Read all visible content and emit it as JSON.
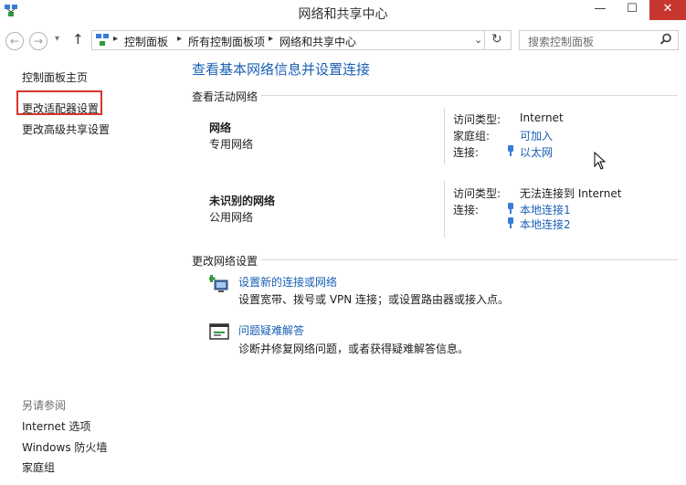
{
  "window": {
    "title": "网络和共享中心",
    "minimize": "—",
    "maximize": "☐",
    "close": "✕"
  },
  "addressbar": {
    "back": "←",
    "forward": "→",
    "dropdown": "▾",
    "up": "↑",
    "crumbs": [
      "控制面板",
      "所有控制面板项",
      "网络和共享中心"
    ],
    "search_placeholder": "搜索控制面板"
  },
  "sidebar": {
    "home": "控制面板主页",
    "items": [
      "更改适配器设置",
      "更改高级共享设置"
    ],
    "see_also_title": "另请参阅",
    "see_also": [
      "Internet 选项",
      "Windows 防火墙",
      "家庭组"
    ]
  },
  "main": {
    "heading": "查看基本网络信息并设置连接",
    "active_networks_title": "查看活动网络",
    "networks": [
      {
        "name": "网络",
        "type": "专用网络",
        "access_label": "访问类型:",
        "access_value": "Internet",
        "homegroup_label": "家庭组:",
        "homegroup_value": "可加入",
        "conn_label": "连接:",
        "connections": [
          "以太网"
        ]
      },
      {
        "name": "未识别的网络",
        "type": "公用网络",
        "access_label": "访问类型:",
        "access_value": "无法连接到 Internet",
        "conn_label": "连接:",
        "connections": [
          "本地连接1",
          "本地连接2"
        ]
      }
    ],
    "change_settings_title": "更改网络设置",
    "tasks": [
      {
        "title": "设置新的连接或网络",
        "desc": "设置宽带、拨号或 VPN 连接；或设置路由器或接入点。"
      },
      {
        "title": "问题疑难解答",
        "desc": "诊断并修复网络问题，或者获得疑难解答信息。"
      }
    ]
  },
  "colors": {
    "link": "#1a5fb4",
    "highlight": "#d9342b",
    "close": "#c7372f"
  }
}
